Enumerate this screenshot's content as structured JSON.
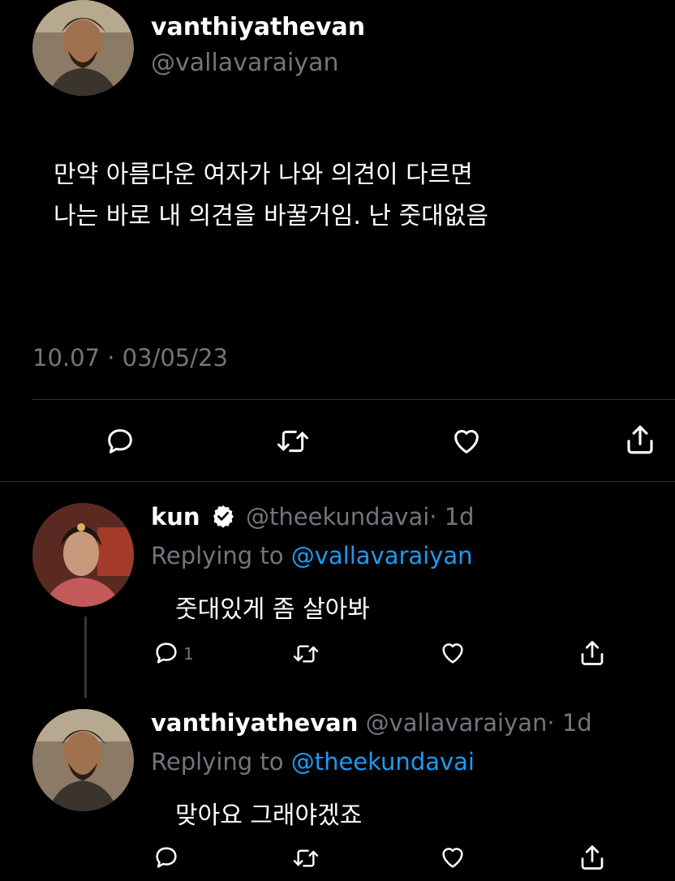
{
  "main_tweet": {
    "author": {
      "display_name": "vanthiyathevan",
      "handle": "@vallavaraiyan"
    },
    "text_lines": [
      "만약 아름다운 여자가 나와 의견이 다르면",
      "나는 바로 내 의견을 바꿀거임. 난 줏대없음"
    ],
    "timestamp": "10.07 · 03/05/23",
    "actions": {
      "reply": "reply-icon",
      "retweet": "retweet-icon",
      "like": "heart-icon",
      "share": "share-icon"
    }
  },
  "replies": [
    {
      "display_name": "kun",
      "verified": true,
      "handle": "@theekundavai",
      "time": "· 1d",
      "replying_prefix": "Replying to",
      "replying_to": "@vallavaraiyan",
      "text": "줏대있게 좀 살아봐",
      "reply_count": "1"
    },
    {
      "display_name": "vanthiyathevan",
      "handle": "@vallavaraiyan",
      "time": "· 1d",
      "replying_prefix": "Replying to",
      "replying_to": "@theekundavai",
      "text": "맞아요 그래야겠죠",
      "reply_count": ""
    }
  ],
  "colors": {
    "background": "#000000",
    "muted": "#71767b",
    "link": "#1d9bf0",
    "divider": "#2f3336"
  }
}
